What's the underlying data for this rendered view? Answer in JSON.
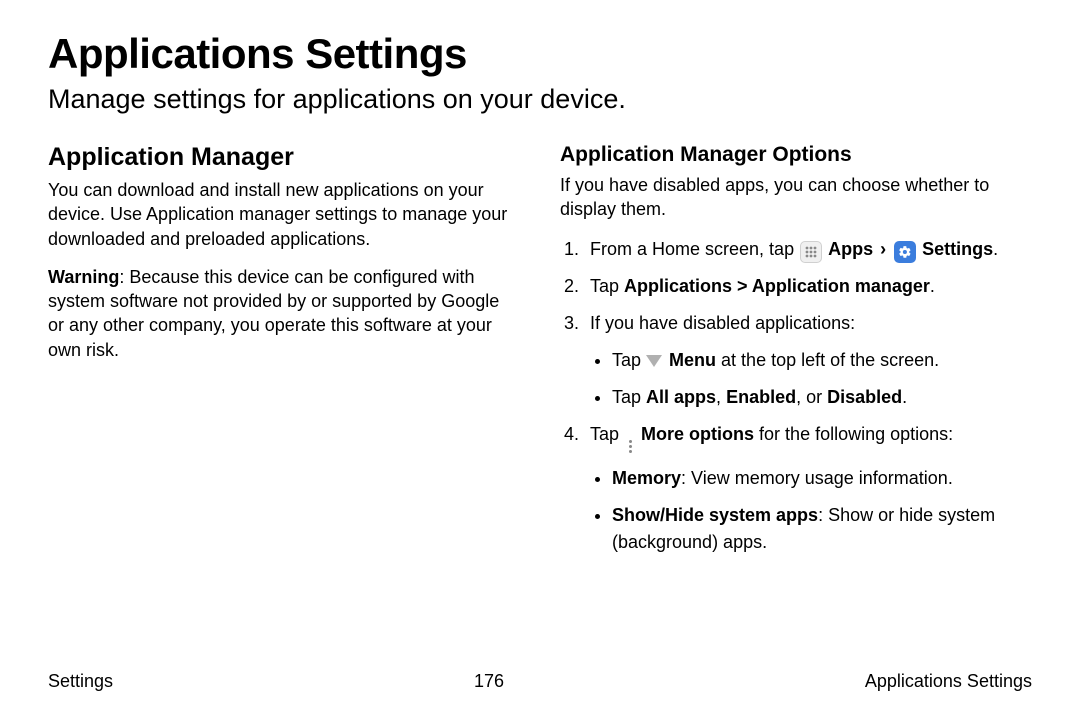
{
  "header": {
    "title": "Applications Settings",
    "subtitle": "Manage settings for applications on your device."
  },
  "left": {
    "heading": "Application Manager",
    "p1": "You can download and install new applications on your device. Use Application manager settings to manage your downloaded and preloaded applications.",
    "warn_label": "Warning",
    "warn_text": ": Because this device can be configured with system software not provided by or supported by Google or any other company, you operate this software at your own risk."
  },
  "right": {
    "heading": "Application Manager Options",
    "intro": "If you have disabled apps, you can choose whether to display them.",
    "step1_a": "From a Home screen, tap ",
    "apps_label": "Apps",
    "chevron": "›",
    "settings_label": "Settings",
    "period": ".",
    "step2_a": "Tap ",
    "step2_b": "Applications > Application manager",
    "step3": "If you have disabled applications:",
    "s3b1_a": "Tap ",
    "s3b1_b": "Menu",
    "s3b1_c": " at the top left of the screen.",
    "s3b2_a": "Tap ",
    "s3b2_b": "All apps",
    "s3b2_c": ", ",
    "s3b2_d": "Enabled",
    "s3b2_e": ", or ",
    "s3b2_f": "Disabled",
    "step4_a": "Tap ",
    "step4_b": "More options",
    "step4_c": " for the following options:",
    "s4b1_a": "Memory",
    "s4b1_b": ": View memory usage information.",
    "s4b2_a": "Show/Hide system apps",
    "s4b2_b": ": Show or hide system (background) apps."
  },
  "footer": {
    "left": "Settings",
    "center": "176",
    "right": "Applications Settings"
  }
}
